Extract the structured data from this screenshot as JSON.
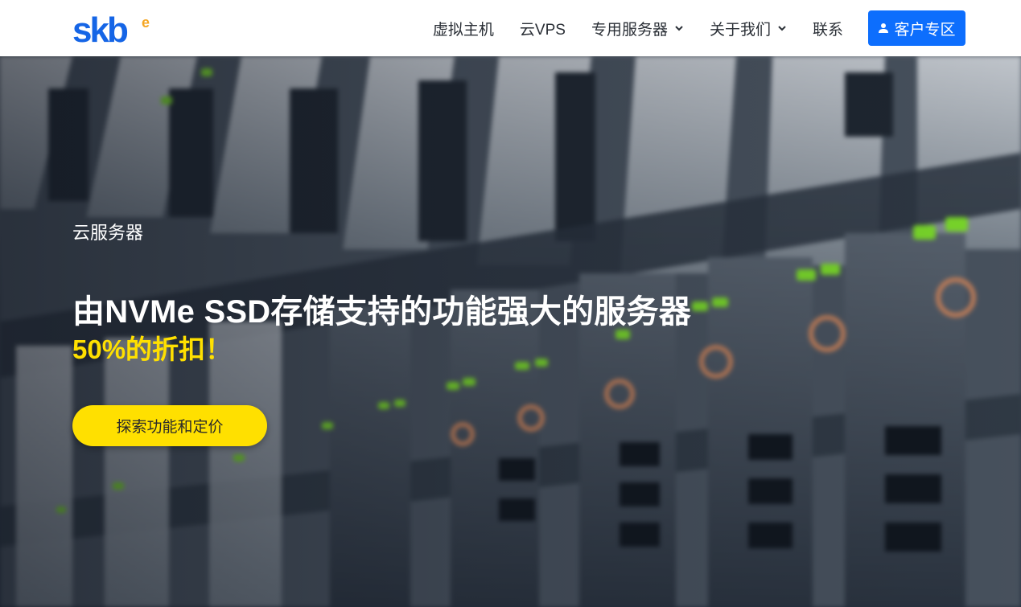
{
  "brand": {
    "name": "skb",
    "superscript": "e",
    "primary_color": "#0d6efd",
    "accent_color": "#f5a623"
  },
  "nav": {
    "items": [
      {
        "label": "虚拟主机",
        "has_dropdown": false
      },
      {
        "label": "云VPS",
        "has_dropdown": false
      },
      {
        "label": "专用服务器",
        "has_dropdown": true
      },
      {
        "label": "关于我们",
        "has_dropdown": true
      },
      {
        "label": "联系",
        "has_dropdown": false
      }
    ],
    "client_area": {
      "label": "客户专区",
      "icon": "user-icon",
      "color": "#0d6efd"
    }
  },
  "hero": {
    "eyebrow": "云服务器",
    "headline": "由NVMe SSD存储支持的功能强大的服务器",
    "subline": "50%的折扣！",
    "subline_color": "#ffe000",
    "cta_label": "探索功能和定价",
    "cta_color": "#ffe000",
    "background": "blurred-server-rack-photo"
  }
}
